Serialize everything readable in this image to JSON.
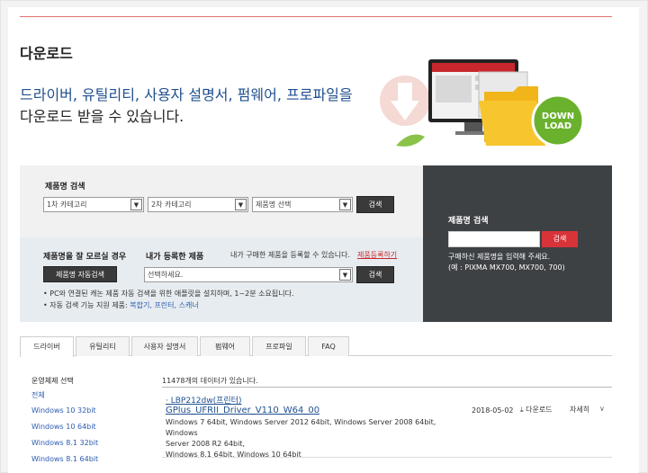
{
  "page": {
    "title": "다운로드",
    "headline1": "드라이버, 유틸리티, 사용자 설명서, 펌웨어, 프로파일을",
    "headline2": "다운로드 받을 수 있습니다."
  },
  "hero": {
    "badge_line1": "DOWN",
    "badge_line2": "LOAD"
  },
  "product_search": {
    "label": "제품명 검색",
    "category1": "1차 카테고리",
    "category2": "2차 카테고리",
    "product_select": "제품명 선택",
    "search_button": "검색"
  },
  "registered": {
    "unknown_label": "제품명을 잘 모르실 경우",
    "auto_search_button": "제품명 자동검색",
    "my_products_label": "내가 등록한 제품",
    "register_notice": "내가 구매한 제품을 등록할 수 있습니다.",
    "register_link": "제품등록하기",
    "select_placeholder": "선택하세요.",
    "search_button": "검색",
    "note1": "• PC와 연결된 캐논 제품 자동 검색을 위한 애플릿을 설치하며, 1~2분 소요됩니다.",
    "note2_prefix": "• 자동 검색 기능 지원 제품: ",
    "note2_links": "복합기, 프린터, 스캐너"
  },
  "name_search": {
    "title": "제품명 검색",
    "button": "검색",
    "hint1": "구매하신 제품명을 입력해 주세요.",
    "hint2": "(예 : PIXMA MX700, MX700, 700)"
  },
  "tabs": [
    {
      "label": "드라이버",
      "active": true
    },
    {
      "label": "유틸리티",
      "active": false
    },
    {
      "label": "사용자 설명서",
      "active": false
    },
    {
      "label": "펌웨어",
      "active": false
    },
    {
      "label": "프로파일",
      "active": false
    },
    {
      "label": "FAQ",
      "active": false
    }
  ],
  "os_filter": {
    "title": "운영체제 선택",
    "items": [
      "전체",
      "Windows 10 32bit",
      "Windows 10 64bit",
      "Windows 8.1 32bit",
      "Windows 8.1 64bit"
    ]
  },
  "results": {
    "count_text": "11478개의 데이터가 있습니다.",
    "items": [
      {
        "name": "· LBP212dw(프린터)",
        "file": "GPlus_UFRII_Driver_V110_W64_00",
        "os_line1": "Windows 7 64bit, Windows Server 2012 64bit, Windows Server 2008 64bit, Windows",
        "os_line2": "Server 2008 R2 64bit,",
        "os_line3": "Windows 8.1 64bit, Windows 10 64bit",
        "date": "2018-05-02",
        "download_label": "다운로드",
        "detail_label": "자세히"
      }
    ]
  },
  "colors": {
    "accent_red": "#d9333a",
    "link_blue": "#1f4f8f",
    "dark_panel": "#3e4144",
    "badge_green": "#6ab12e"
  }
}
